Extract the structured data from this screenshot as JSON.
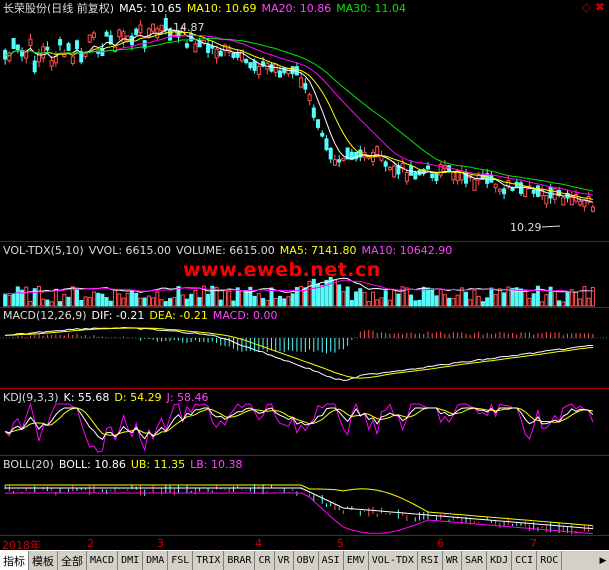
{
  "title": {
    "stock": "长荣股份(日线 前复权)",
    "ma5": "MA5: 10.65",
    "ma10": "MA10: 10.69",
    "ma20": "MA20: 10.86",
    "ma30": "MA30: 11.04"
  },
  "price_annotations": {
    "high": "14.87",
    "low": "10.29"
  },
  "vol": {
    "name": "VOL-TDX(5,10)",
    "vvol": "VVOL: 6615.00",
    "volume": "VOLUME: 6615.00",
    "ma5": "MA5: 7141.80",
    "ma10": "MA10: 10642.90"
  },
  "watermark": "www.eweb.net.cn",
  "macd": {
    "name": "MACD(12,26,9)",
    "dif": "DIF: -0.21",
    "dea": "DEA: -0.21",
    "macd": "MACD: 0.00"
  },
  "kdj": {
    "name": "KDJ(9,3,3)",
    "k": "K: 55.68",
    "d": "D: 54.29",
    "j": "J: 58.46"
  },
  "boll": {
    "name": "BOLL(20)",
    "boll": "BOLL: 10.86",
    "ub": "UB: 11.35",
    "lb": "LB: 10.38"
  },
  "time_axis": [
    "2018年",
    "2",
    "3",
    "4",
    "5",
    "6",
    "7"
  ],
  "tabs": [
    "指标",
    "模板",
    "全部",
    "MACD",
    "DMI",
    "DMA",
    "FSL",
    "TRIX",
    "BRAR",
    "CR",
    "VR",
    "OBV",
    "ASI",
    "EMV",
    "VOL-TDX",
    "RSI",
    "WR",
    "SAR",
    "KDJ",
    "CCI",
    "ROC"
  ],
  "colors": {
    "up": "#ff5050",
    "down": "#54fcfc",
    "ma5": "#ffffff",
    "ma10": "#ffff00",
    "ma20": "#ff00ff",
    "ma30": "#00e600",
    "separator": "#aa0000"
  },
  "chart_data": {
    "type": "candlestick",
    "series": [
      {
        "name": "MA5",
        "values": [
          10.65
        ]
      },
      {
        "name": "MA10",
        "values": [
          10.69
        ]
      },
      {
        "name": "MA20",
        "values": [
          10.86
        ]
      },
      {
        "name": "MA30",
        "values": [
          11.04
        ]
      }
    ],
    "annotations": [
      {
        "text": "14.87",
        "kind": "high"
      },
      {
        "text": "10.29",
        "kind": "low"
      }
    ]
  }
}
